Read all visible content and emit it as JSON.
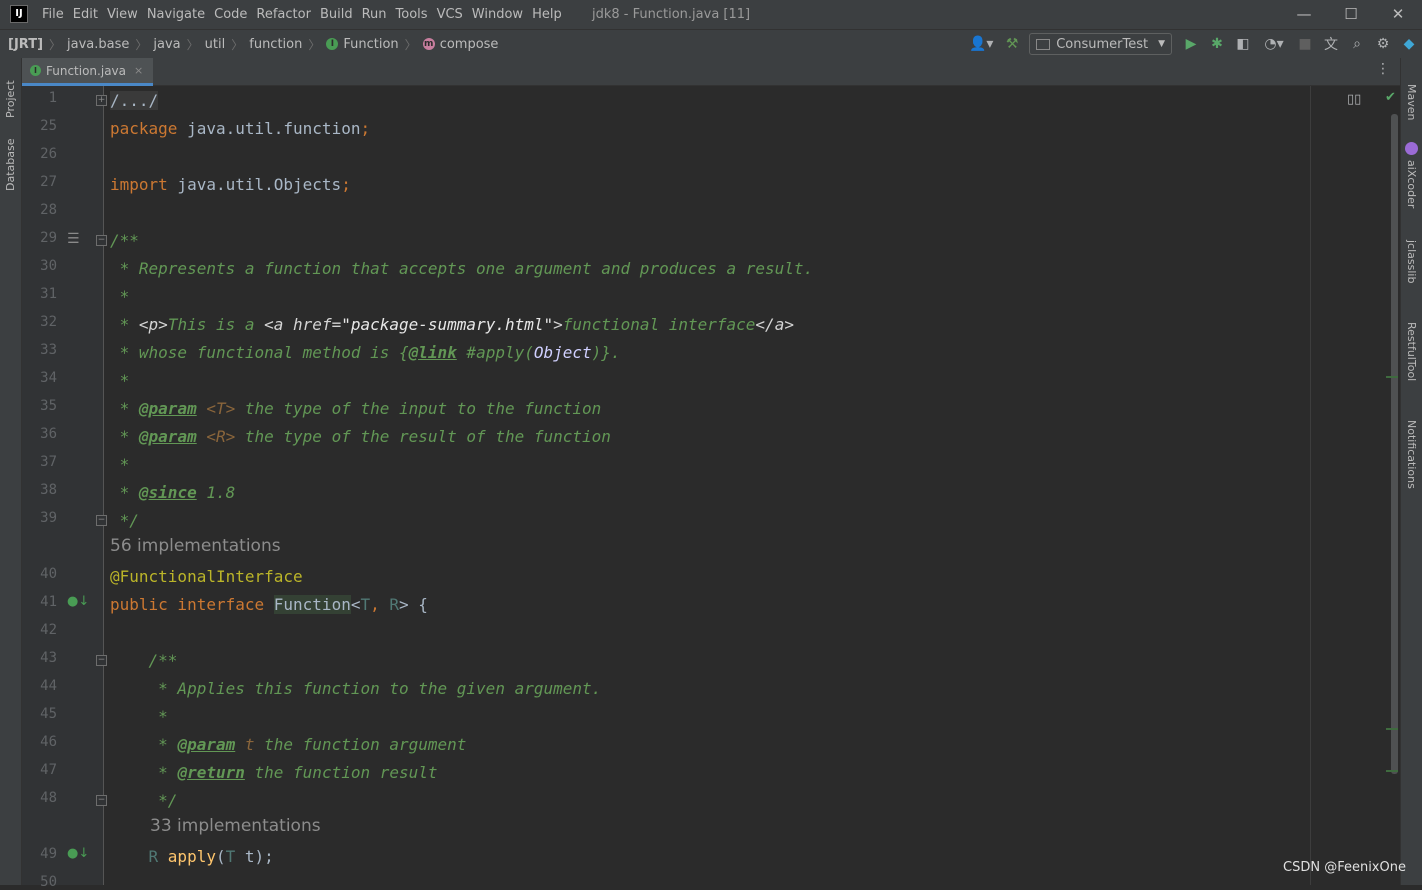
{
  "menubar": {
    "logo": "IJ",
    "items": [
      "File",
      "Edit",
      "View",
      "Navigate",
      "Code",
      "Refactor",
      "Build",
      "Run",
      "Tools",
      "VCS",
      "Window",
      "Help"
    ],
    "title": "jdk8 - Function.java [11]",
    "minimize": "—",
    "maximize": "☐",
    "close": "✕"
  },
  "navbar": {
    "crumbs": [
      {
        "label": "[JRT]"
      },
      {
        "label": "java.base"
      },
      {
        "label": "java"
      },
      {
        "label": "util"
      },
      {
        "label": "function"
      },
      {
        "label": "Function",
        "icon": "I",
        "icon_color": "#499c54"
      },
      {
        "label": "compose",
        "icon": "m",
        "icon_color": "#c77e9e"
      }
    ],
    "run_config": "ConsumerTest"
  },
  "left_strip": {
    "tabs": [
      "Project",
      "Database"
    ]
  },
  "right_strip": {
    "tabs": [
      "Maven",
      "aiXcoder",
      "jclasslib",
      "RestfulTool",
      "Notifications"
    ]
  },
  "tab": {
    "label": "Function.java",
    "close": "×"
  },
  "gutter": {
    "line_numbers": [
      "1",
      "25",
      "26",
      "27",
      "28",
      "29",
      "30",
      "31",
      "32",
      "33",
      "34",
      "35",
      "36",
      "37",
      "38",
      "39",
      "40",
      "41",
      "42",
      "43",
      "44",
      "45",
      "46",
      "47",
      "48",
      "49",
      "50"
    ]
  },
  "code": {
    "folded": "/.../",
    "package_kw": "package",
    "package_name": " java.util.function",
    "semi": ";",
    "import_kw": "import",
    "import_name": " java.util.Objects",
    "doc1_open": "/**",
    "doc1_l1": " * Represents a function that accepts one argument and produces a result.",
    "doc1_l2": " *",
    "doc1_l3a": " * ",
    "doc1_l3_p": "<p>",
    "doc1_l3b": "This is a ",
    "doc1_l3_a_open": "<a href=",
    "doc1_l3_href": "\"package-summary.html\"",
    "doc1_l3_gt": ">",
    "doc1_l3c": "functional interface",
    "doc1_l3_a_close": "</a>",
    "doc1_l4a": " * whose functional method is {",
    "doc1_l4_link": "@link",
    "doc1_l4b": " #apply(",
    "doc1_l4_obj": "Object",
    "doc1_l4c": ")}.",
    "doc1_l5": " *",
    "doc1_l6a": " * ",
    "doc1_l6_tag": "@param",
    "doc1_l6_t": " <T>",
    "doc1_l6b": " the type of the input to the function",
    "doc1_l7a": " * ",
    "doc1_l7_tag": "@param",
    "doc1_l7_r": " <R>",
    "doc1_l7b": " the type of the result of the function",
    "doc1_l8": " *",
    "doc1_l9a": " * ",
    "doc1_l9_tag": "@since",
    "doc1_l9b": " 1.8",
    "doc1_close": " */",
    "impl1": "56 implementations",
    "annotation": "@FunctionalInterface",
    "public_kw": "public",
    "interface_kw": " interface ",
    "iface_name": "Function",
    "lt": "<",
    "tp_t": "T",
    "comma": ", ",
    "tp_r": "R",
    "gt_brace": "> {",
    "doc2_open": "    /**",
    "doc2_l1": "     * Applies this function to the given argument.",
    "doc2_l2": "     *",
    "doc2_l3a": "     * ",
    "doc2_l3_tag": "@param",
    "doc2_l3_t": " t",
    "doc2_l3b": " the function argument",
    "doc2_l4a": "     * ",
    "doc2_l4_tag": "@return",
    "doc2_l4b": " the function result",
    "doc2_close": "     */",
    "impl2": "33 implementations",
    "apply_ret": "    R ",
    "apply_name": "apply",
    "apply_open": "(",
    "apply_t": "T",
    "apply_rest": " t);"
  },
  "watermark": "CSDN @FeenixOne"
}
